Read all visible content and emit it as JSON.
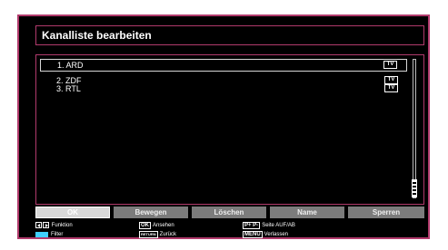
{
  "title": "Kanalliste bearbeiten",
  "channels": [
    {
      "label": "1. ARD",
      "type": "TV",
      "selected": true
    },
    {
      "label": "2. ZDF",
      "type": "TV",
      "selected": false
    },
    {
      "label": "3. RTL",
      "type": "TV",
      "selected": false
    }
  ],
  "buttons": {
    "ok": "OK",
    "move": "Bewegen",
    "delete": "Löschen",
    "name": "Name",
    "lock": "Sperren"
  },
  "legend": {
    "function": "Funktion",
    "filter": "Filter",
    "ok_key": "OK",
    "view": "Ansehen",
    "return_key": "RETURN",
    "back": "Zurück",
    "page_key": "P+ P-",
    "page_updown": "Seite AUF/AB",
    "menu_key": "MENU",
    "exit": "Verlassen"
  },
  "colors": {
    "frame": "#b13a6c",
    "blue_key": "#3fd0ff"
  }
}
